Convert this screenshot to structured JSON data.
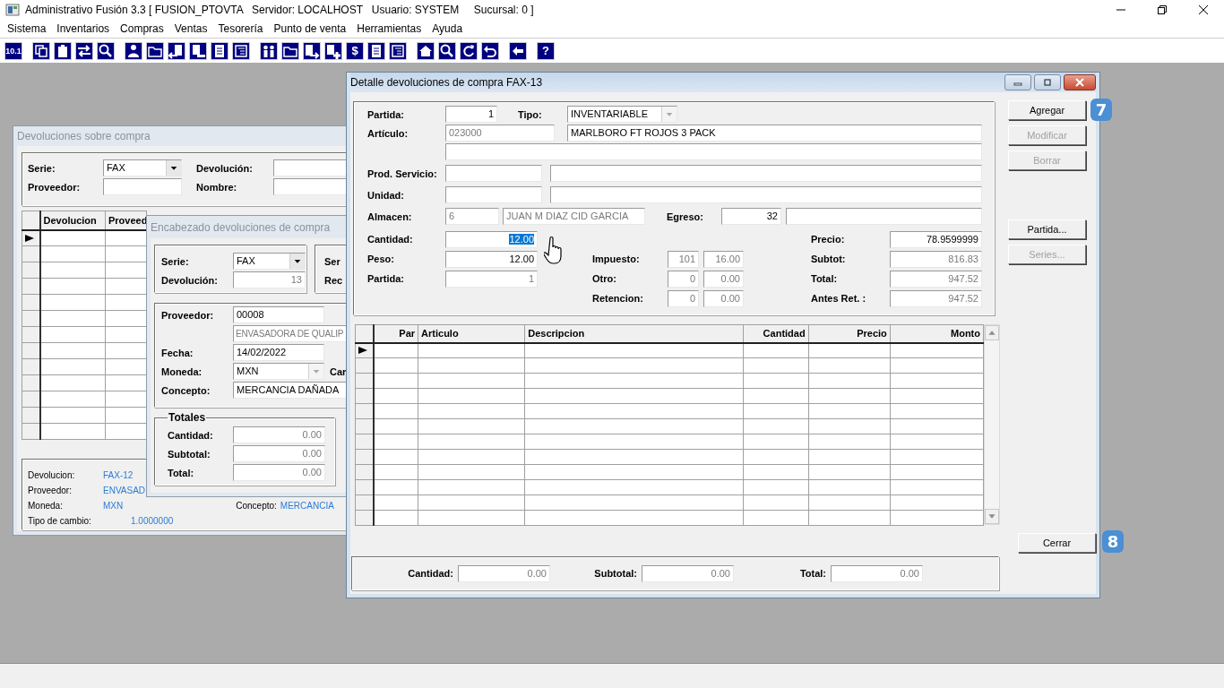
{
  "app": {
    "title": "Administrativo Fusión 3.3 [ FUSION_PTOVTA   Servidor: LOCALHOST   Usuario: SYSTEM     Sucursal: 0 ]"
  },
  "menu": [
    "Sistema",
    "Inventarios",
    "Compras",
    "Ventas",
    "Tesorería",
    "Punto de venta",
    "Herramientas",
    "Ayuda"
  ],
  "toolbar": {
    "labels": [
      "10.1",
      "$",
      "?"
    ]
  },
  "back_window": {
    "title": "Devoluciones sobre compra",
    "filters": [
      [
        {
          "label": "Serie:",
          "field": {
            "kind": "combo",
            "value": "FAX",
            "disabled": false
          }
        },
        {
          "label": "Devolución:",
          "field": {
            "kind": "field"
          }
        }
      ],
      [
        {
          "label": "Proveedor:",
          "field": {
            "kind": "field"
          }
        },
        {
          "label": "Nombre:",
          "field": {
            "kind": "field"
          }
        }
      ]
    ],
    "grid": {
      "columns": [
        "Devolucion",
        "Proveed"
      ],
      "rows": [
        {
          "selected": true
        },
        {
          "selected": false
        },
        {
          "selected": false
        },
        {
          "selected": false
        },
        {
          "selected": false
        },
        {
          "selected": false
        },
        {
          "selected": false
        },
        {
          "selected": false
        },
        {
          "selected": false
        },
        {
          "selected": false
        },
        {
          "selected": false
        },
        {
          "selected": false
        },
        {
          "selected": false
        }
      ]
    },
    "info": [
      [
        {
          "label": "Devolucion:",
          "value": "FAX-12"
        }
      ],
      [
        {
          "label": "Proveedor:",
          "value": "ENVASAD"
        }
      ],
      [
        {
          "label": "Moneda:",
          "value": "MXN"
        },
        {
          "label": "Concepto:",
          "value": "MERCANCIA"
        }
      ],
      [
        {
          "label": "Tipo de cambio:",
          "value": "1.0000000"
        }
      ]
    ]
  },
  "header_window": {
    "title": "Encabezado devoluciones de compra",
    "serie_group": [
      {
        "label": "Serie:",
        "field": {
          "kind": "combo",
          "value": "FAX",
          "disabled": false
        }
      },
      {
        "label": "Devolución:",
        "field": {
          "kind": "field",
          "value": "13",
          "numeric": true,
          "readonly": true
        }
      }
    ],
    "side_labels": [
      "Ser",
      "Rec"
    ],
    "supplier_group": [
      {
        "label": "Proveedor:",
        "field": {
          "kind": "field",
          "value": "00008"
        }
      },
      {
        "field": {
          "kind": "field",
          "value": "ENVASADORA DE QUALIP",
          "readonly": true
        }
      },
      {
        "label": "Fecha:",
        "field": {
          "kind": "field",
          "value": "14/02/2022"
        }
      },
      {
        "label": "Moneda:",
        "field": {
          "kind": "combo",
          "value": "MXN",
          "disabled": true
        },
        "side_label": "Car"
      },
      {
        "label": "Concepto:",
        "field": {
          "kind": "field",
          "value": "MERCANCIA DAÑADA"
        }
      }
    ],
    "totals": {
      "title": "Totales",
      "rows": [
        {
          "label": "Cantidad:",
          "field": {
            "kind": "field",
            "value": "0.00",
            "numeric": true,
            "readonly": true
          }
        },
        {
          "label": "Subtotal:",
          "field": {
            "kind": "field",
            "value": "0.00",
            "numeric": true,
            "readonly": true
          }
        },
        {
          "label": "Total:",
          "field": {
            "kind": "field",
            "value": "0.00",
            "numeric": true,
            "readonly": true
          }
        }
      ]
    }
  },
  "detail_window": {
    "title": "Detalle devoluciones de compra FAX-13",
    "rows": [
      [
        {
          "kind": "label",
          "text": "Partida:"
        },
        {
          "kind": "field",
          "value": "1",
          "numeric": true
        },
        {
          "kind": "pair",
          "label": "Tipo:",
          "field": {
            "kind": "combo",
            "value": "INVENTARIABLE",
            "disabled": true
          }
        }
      ],
      [
        {
          "kind": "label",
          "text": "Artículo:"
        },
        {
          "kind": "field",
          "value": "023000",
          "readonly": true
        },
        {
          "kind": "field",
          "value": "MARLBORO FT ROJOS 3 PACK"
        }
      ],
      [
        {
          "kind": "field"
        }
      ],
      [
        {
          "kind": "label",
          "text": "Prod. Servicio:"
        },
        {
          "kind": "field"
        },
        {
          "kind": "field"
        }
      ],
      [
        {
          "kind": "label",
          "text": "Unidad:"
        },
        {
          "kind": "field"
        },
        {
          "kind": "field"
        }
      ],
      [
        {
          "kind": "label",
          "text": "Almacen:"
        },
        {
          "kind": "field",
          "value": "6",
          "readonly": true
        },
        {
          "kind": "field",
          "value": "JUAN M DIAZ CID GARCIA",
          "readonly": true
        },
        {
          "kind": "pair",
          "label": "Egreso:",
          "field": {
            "kind": "field",
            "value": "32",
            "numeric": true
          }
        },
        {
          "kind": "field"
        }
      ]
    ],
    "quantities": [
      {
        "label": "Cantidad:",
        "field": {
          "kind": "field",
          "value": "12.00",
          "numeric": true,
          "text_selected": true
        }
      },
      {
        "label": "Peso:",
        "field": {
          "kind": "field",
          "value": "12.00",
          "numeric": true,
          "text_selected": false
        }
      },
      {
        "label": "Partida:",
        "field": {
          "kind": "field",
          "value": "1",
          "numeric": true,
          "readonly": true
        }
      }
    ],
    "taxes": [
      {
        "label": "Impuesto:",
        "fields": [
          {
            "kind": "field",
            "value": "101",
            "numeric": true,
            "readonly": true
          },
          {
            "kind": "field",
            "value": "16.00",
            "numeric": true,
            "readonly": true
          }
        ]
      },
      {
        "label": "Otro:",
        "fields": [
          {
            "kind": "field",
            "value": "0",
            "numeric": true,
            "readonly": true
          },
          {
            "kind": "field",
            "value": "0.00",
            "numeric": true,
            "readonly": true
          }
        ]
      },
      {
        "label": "Retencion:",
        "fields": [
          {
            "kind": "field",
            "value": "0",
            "numeric": true,
            "readonly": true
          },
          {
            "kind": "field",
            "value": "0.00",
            "numeric": true,
            "readonly": true
          }
        ]
      }
    ],
    "totals": [
      {
        "label": "Precio:",
        "field": {
          "kind": "field",
          "value": "78.9599999",
          "numeric": true
        }
      },
      {
        "label": "Subtot:",
        "field": {
          "kind": "field",
          "value": "816.83",
          "numeric": true,
          "readonly": true
        }
      },
      {
        "label": "Total:",
        "field": {
          "kind": "field",
          "value": "947.52",
          "numeric": true,
          "readonly": true
        }
      },
      {
        "label": "Antes Ret. :",
        "field": {
          "kind": "field",
          "value": "947.52",
          "numeric": true,
          "readonly": true
        }
      }
    ],
    "buttons": [
      {
        "label": "Agregar",
        "disabled": false
      },
      {
        "label": "Modificar",
        "disabled": true
      },
      {
        "label": "Borrar",
        "disabled": true
      },
      {
        "label": "Partida...",
        "disabled": false
      },
      {
        "label": "Series...",
        "disabled": true
      }
    ],
    "grid": {
      "columns": [
        "Par",
        "Articulo",
        "Descripcion",
        "Cantidad",
        "Precio",
        "Monto"
      ],
      "rows": [
        {
          "selected": true
        },
        {
          "selected": false
        },
        {
          "selected": false
        },
        {
          "selected": false
        },
        {
          "selected": false
        },
        {
          "selected": false
        },
        {
          "selected": false
        },
        {
          "selected": false
        },
        {
          "selected": false
        },
        {
          "selected": false
        },
        {
          "selected": false
        },
        {
          "selected": false
        }
      ]
    },
    "close_button": "Cerrar",
    "footer": [
      {
        "label": "Cantidad:",
        "field": {
          "kind": "field",
          "value": "0.00",
          "numeric": true,
          "readonly": true
        }
      },
      {
        "label": "Subtotal:",
        "field": {
          "kind": "field",
          "value": "0.00",
          "numeric": true,
          "readonly": true
        }
      },
      {
        "label": "Total:",
        "field": {
          "kind": "field",
          "value": "0.00",
          "numeric": true,
          "readonly": true
        }
      }
    ]
  },
  "badges": [
    "7",
    "8"
  ]
}
